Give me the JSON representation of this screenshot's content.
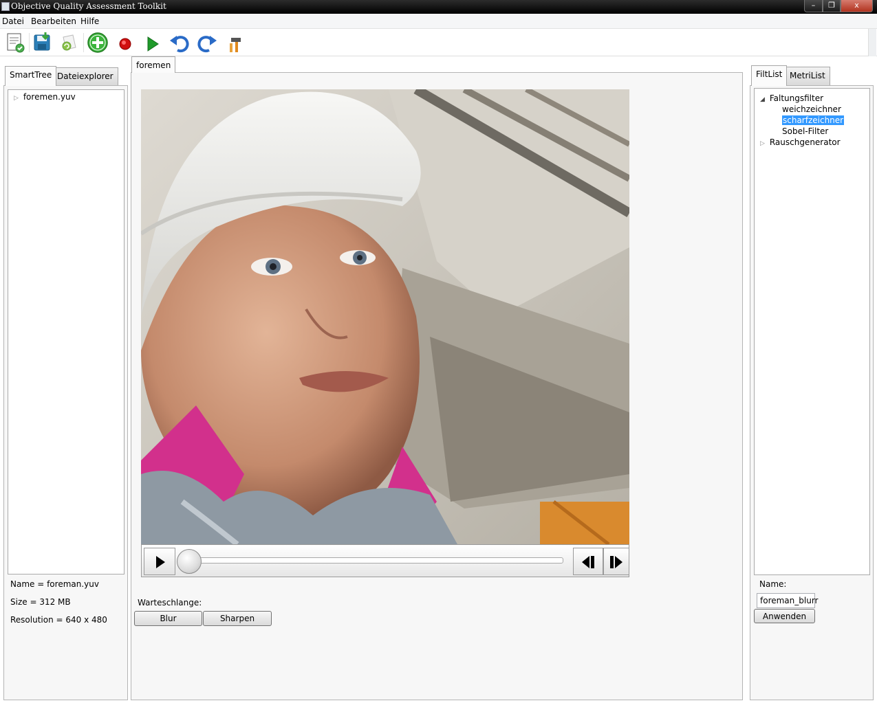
{
  "window": {
    "title": "Objective Quality Assessment Toolkit",
    "minimize_glyph": "–",
    "maximize_glyph": "❐",
    "close_glyph": "x"
  },
  "menu": {
    "items": [
      "Datei",
      "Bearbeiten",
      "Hilfe"
    ]
  },
  "toolbar": {
    "icons": [
      "new-document-icon",
      "save-icon",
      "refresh-document-icon",
      "add-icon",
      "record-icon",
      "play-icon",
      "undo-icon",
      "redo-icon",
      "hammer-icon"
    ]
  },
  "left_panel": {
    "tabs": [
      "SmartTree",
      "Dateiexplorer"
    ],
    "active_tab": "SmartTree",
    "tree": [
      {
        "label": "foremen.yuv",
        "expandable": true
      }
    ],
    "info": [
      "Name = foreman.yuv",
      "Size = 312 MB",
      "Resolution = 640 x 480"
    ]
  },
  "center_panel": {
    "tab": "foremen",
    "video_frame": "foreman-video-frame",
    "playback": {
      "position": 0.0
    },
    "queue_label": "Warteschlange:",
    "queue_buttons": [
      "Blur",
      "Sharpen"
    ]
  },
  "right_panel": {
    "tabs": [
      "FiltList",
      "MetriList"
    ],
    "active_tab": "FiltList",
    "tree": {
      "group1": "Faltungsfilter",
      "children": [
        "weichzeichner",
        "scharfzeichner",
        "Sobel-Filter"
      ],
      "selected": "scharfzeichner",
      "group2": "Rauschgenerator"
    },
    "name_label": "Name:",
    "name_value": "foreman_blurr",
    "apply_button": "Anwenden"
  },
  "colors": {
    "selection": "#3399ff",
    "panel_bg": "#f7f7f7",
    "titlebar": "#000000"
  }
}
